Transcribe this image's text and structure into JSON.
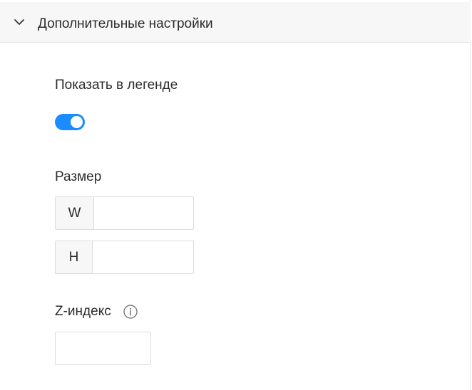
{
  "section": {
    "title": "Дополнительные настройки",
    "expanded": true,
    "chevron_icon": "chevron-down-icon"
  },
  "legend": {
    "label": "Показать в легенде",
    "toggle_on": true,
    "toggle_color": "#1a8cff"
  },
  "size": {
    "label": "Размер",
    "width_addon": "W",
    "width_value": "",
    "height_addon": "H",
    "height_value": ""
  },
  "z_index": {
    "label": "Z-индекс",
    "info_icon": "info-icon",
    "value": ""
  }
}
